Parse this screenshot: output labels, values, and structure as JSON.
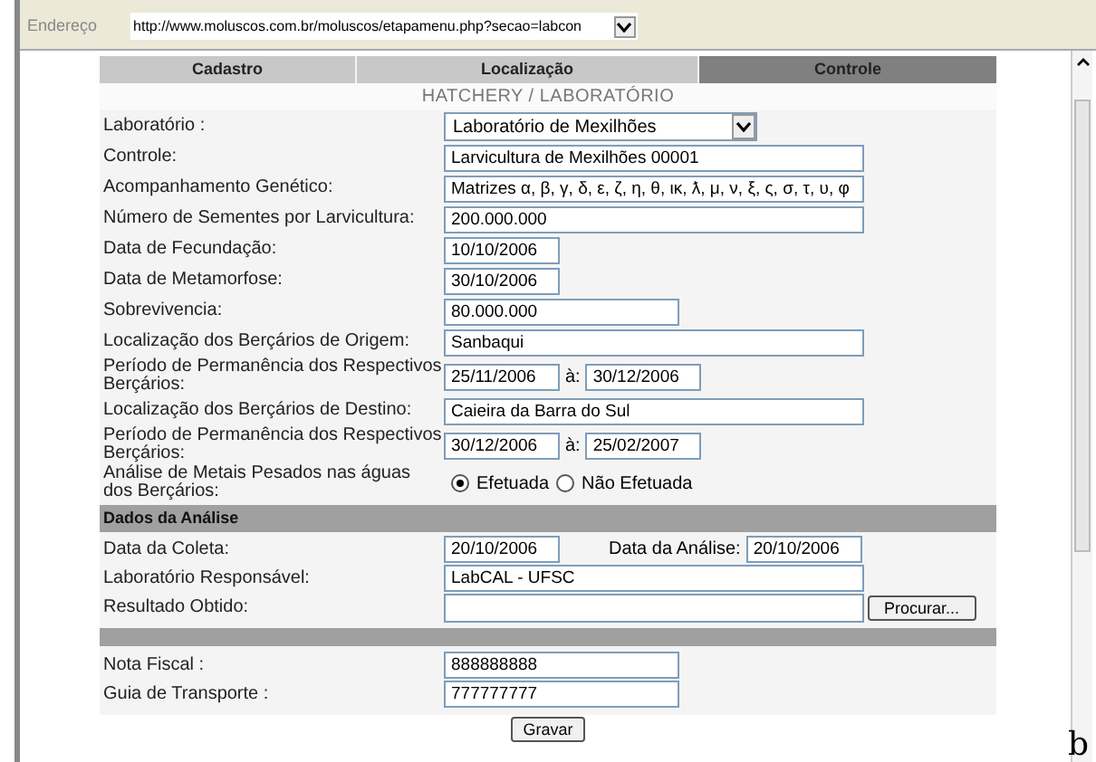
{
  "address_bar": {
    "label": "Endereço",
    "url": "http://www.moluscos.com.br/moluscos/etapamenu.php?secao=labcon"
  },
  "tabs": [
    {
      "label": "Cadastro",
      "selected": false
    },
    {
      "label": "Localização",
      "selected": false
    },
    {
      "label": "Controle",
      "selected": true
    }
  ],
  "title": "HATCHERY / LABORATÓRIO",
  "fields": [
    {
      "kind": "select",
      "label": "Laboratório :",
      "value": "Laboratório de Mexilhões"
    },
    {
      "kind": "text",
      "label": "Controle:",
      "value": "Larvicultura de Mexilhões 00001"
    },
    {
      "kind": "text",
      "label": "Acompanhamento Genético:",
      "value": "Matrizes α, β, γ, δ, ε, ζ, η, θ, ικ, ƛ, μ, ν, ξ, ς, σ, τ, υ, φ"
    },
    {
      "kind": "text",
      "label": "Número de Sementes por Larvicultura:",
      "value": "200.000.000"
    },
    {
      "kind": "date",
      "label": "Data de Fecundação:",
      "value": "10/10/2006"
    },
    {
      "kind": "date",
      "label": "Data de Metamorfose:",
      "value": "30/10/2006"
    },
    {
      "kind": "number",
      "label": "Sobrevivencia:",
      "value": "80.000.000"
    },
    {
      "kind": "text",
      "label": "Localização dos Berçários de Origem:",
      "value": "Sanbaqui"
    },
    {
      "kind": "date_range",
      "label": "Período de Permanência dos Respectivos Berçários:",
      "value": "25/11/2006",
      "separator": "à:",
      "value_to": "30/12/2006"
    },
    {
      "kind": "text",
      "label": "Localização dos Berçários de Destino:",
      "value": "Caieira da Barra do Sul"
    },
    {
      "kind": "date_range",
      "label": "Período de Permanência dos Respectivos Berçários:",
      "value": "30/12/2006",
      "separator": "à:",
      "value_to": "25/02/2007"
    },
    {
      "kind": "radio",
      "label": "Análise de Metais Pesados nas águas dos Berçários:",
      "options": [
        {
          "label": "Efetuada",
          "selected": true
        },
        {
          "label": "Não Efetuada",
          "selected": false
        }
      ]
    }
  ],
  "analysis": {
    "heading": "Dados da Análise",
    "collect_label": "Data da Coleta:",
    "collect_value": "20/10/2006",
    "analysis_label": "Data da Análise:",
    "analysis_value": "20/10/2006",
    "lab_label": "Laboratório Responsável:",
    "lab_value": "LabCAL - UFSC",
    "result_label": "Resultado Obtido:",
    "browse_button": "Procurar..."
  },
  "invoice": {
    "label": "Nota Fiscal :",
    "value": "888888888"
  },
  "transport": {
    "label": "Guia de Transporte :",
    "value": "777777777"
  },
  "save_button": "Gravar",
  "caption_fragment": "b"
}
